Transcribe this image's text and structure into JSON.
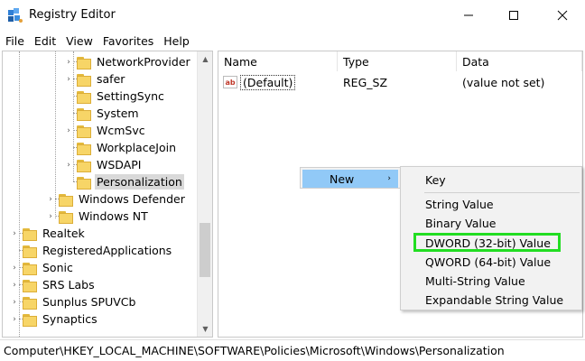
{
  "window": {
    "title": "Registry Editor",
    "controls": [
      "minimize",
      "maximize",
      "close"
    ]
  },
  "menu": [
    "File",
    "Edit",
    "View",
    "Favorites",
    "Help"
  ],
  "tree": [
    {
      "label": "NetworkProvider",
      "expander": "›"
    },
    {
      "label": "safer",
      "expander": "›"
    },
    {
      "label": "SettingSync",
      "expander": ""
    },
    {
      "label": "System",
      "expander": ""
    },
    {
      "label": "WcmSvc",
      "expander": "›"
    },
    {
      "label": "WorkplaceJoin",
      "expander": ""
    },
    {
      "label": "WSDAPI",
      "expander": "›"
    },
    {
      "label": "Personalization",
      "expander": ""
    },
    {
      "label": "Windows Defender",
      "expander": "›"
    },
    {
      "label": "Windows NT",
      "expander": "›"
    },
    {
      "label": "Realtek",
      "expander": "›"
    },
    {
      "label": "RegisteredApplications",
      "expander": ""
    },
    {
      "label": "Sonic",
      "expander": "›"
    },
    {
      "label": "SRS Labs",
      "expander": "›"
    },
    {
      "label": "Sunplus SPUVCb",
      "expander": "›"
    },
    {
      "label": "Synaptics",
      "expander": "›"
    }
  ],
  "columns": [
    "Name",
    "Type",
    "Data"
  ],
  "values": [
    {
      "name": "(Default)",
      "type": "REG_SZ",
      "data": "(value not set)",
      "icon": "ab"
    }
  ],
  "context_menu": {
    "new_label": "New",
    "arrow": "›"
  },
  "submenu": [
    "Key",
    "String Value",
    "Binary Value",
    "DWORD (32-bit) Value",
    "QWORD (64-bit) Value",
    "Multi-String Value",
    "Expandable String Value"
  ],
  "highlight_color": "#22dd22",
  "status_path": "Computer\\HKEY_LOCAL_MACHINE\\SOFTWARE\\Policies\\Microsoft\\Windows\\Personalization"
}
